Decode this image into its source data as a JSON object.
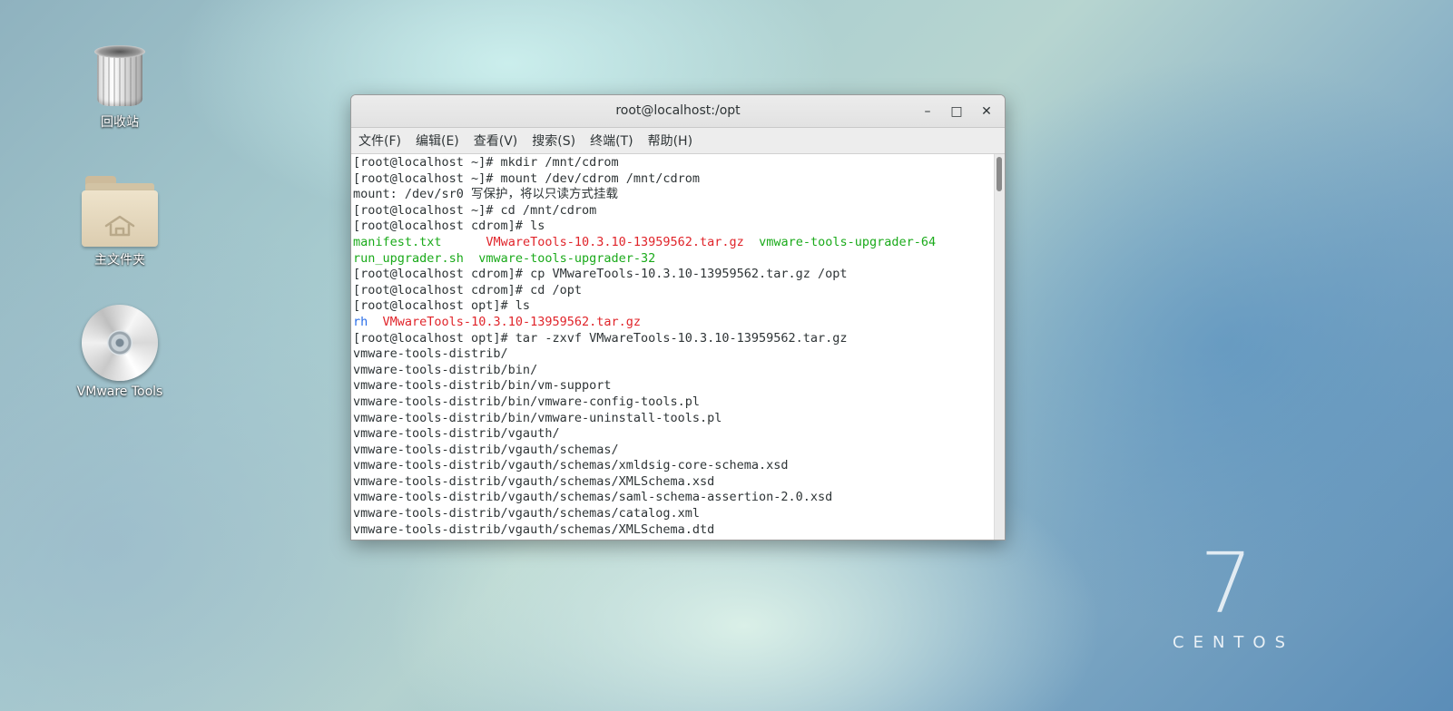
{
  "desktop": {
    "icons": [
      {
        "label": "回收站",
        "icon": "trash-icon"
      },
      {
        "label": "主文件夹",
        "icon": "home-folder-icon"
      },
      {
        "label": "VMware Tools",
        "icon": "disc-icon"
      }
    ],
    "brand": {
      "number": "7",
      "word": "CENTOS"
    }
  },
  "window": {
    "title": "root@localhost:/opt",
    "controls": {
      "minimize": "–",
      "maximize": "□",
      "close": "✕"
    },
    "menu": [
      "文件(F)",
      "编辑(E)",
      "查看(V)",
      "搜索(S)",
      "终端(T)",
      "帮助(H)"
    ]
  },
  "colors": {
    "default_text": "#2e3436",
    "green": "#1aaa1a",
    "red": "#e0242a",
    "blue": "#2a6ee8"
  },
  "terminal": {
    "lines": [
      [
        {
          "text": "[root@localhost ~]# mkdir /mnt/cdrom"
        }
      ],
      [
        {
          "text": "[root@localhost ~]# mount /dev/cdrom /mnt/cdrom"
        }
      ],
      [
        {
          "text": "mount: /dev/sr0 写保护，将以只读方式挂载"
        }
      ],
      [
        {
          "text": "[root@localhost ~]# cd /mnt/cdrom"
        }
      ],
      [
        {
          "text": "[root@localhost cdrom]# ls"
        }
      ],
      [
        {
          "text": "manifest.txt",
          "color": "green"
        },
        {
          "text": "      "
        },
        {
          "text": "VMwareTools-10.3.10-13959562.tar.gz",
          "color": "red"
        },
        {
          "text": "  "
        },
        {
          "text": "vmware-tools-upgrader-64",
          "color": "green"
        }
      ],
      [
        {
          "text": "run_upgrader.sh",
          "color": "green"
        },
        {
          "text": "  "
        },
        {
          "text": "vmware-tools-upgrader-32",
          "color": "green"
        }
      ],
      [
        {
          "text": "[root@localhost cdrom]# cp VMwareTools-10.3.10-13959562.tar.gz /opt"
        }
      ],
      [
        {
          "text": "[root@localhost cdrom]# cd /opt"
        }
      ],
      [
        {
          "text": "[root@localhost opt]# ls"
        }
      ],
      [
        {
          "text": "rh",
          "color": "blue"
        },
        {
          "text": "  "
        },
        {
          "text": "VMwareTools-10.3.10-13959562.tar.gz",
          "color": "red"
        }
      ],
      [
        {
          "text": "[root@localhost opt]# tar -zxvf VMwareTools-10.3.10-13959562.tar.gz"
        }
      ],
      [
        {
          "text": "vmware-tools-distrib/"
        }
      ],
      [
        {
          "text": "vmware-tools-distrib/bin/"
        }
      ],
      [
        {
          "text": "vmware-tools-distrib/bin/vm-support"
        }
      ],
      [
        {
          "text": "vmware-tools-distrib/bin/vmware-config-tools.pl"
        }
      ],
      [
        {
          "text": "vmware-tools-distrib/bin/vmware-uninstall-tools.pl"
        }
      ],
      [
        {
          "text": "vmware-tools-distrib/vgauth/"
        }
      ],
      [
        {
          "text": "vmware-tools-distrib/vgauth/schemas/"
        }
      ],
      [
        {
          "text": "vmware-tools-distrib/vgauth/schemas/xmldsig-core-schema.xsd"
        }
      ],
      [
        {
          "text": "vmware-tools-distrib/vgauth/schemas/XMLSchema.xsd"
        }
      ],
      [
        {
          "text": "vmware-tools-distrib/vgauth/schemas/saml-schema-assertion-2.0.xsd"
        }
      ],
      [
        {
          "text": "vmware-tools-distrib/vgauth/schemas/catalog.xml"
        }
      ],
      [
        {
          "text": "vmware-tools-distrib/vgauth/schemas/XMLSchema.dtd"
        }
      ]
    ]
  }
}
